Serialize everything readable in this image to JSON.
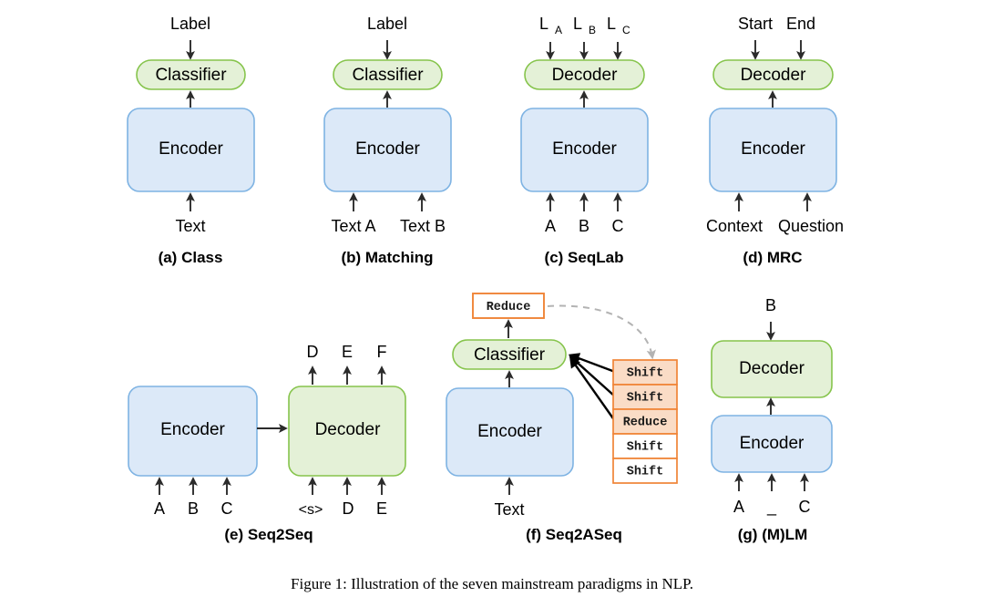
{
  "figure": {
    "caption": "Figure 1: Illustration of the seven mainstream paradigms in NLP.",
    "background": "#ffffff"
  },
  "colors": {
    "encoder_fill": "#dce9f8",
    "encoder_stroke": "#7eb3e3",
    "decoder_fill": "#e4f1d7",
    "decoder_stroke": "#86c44c",
    "stack_fill": "#fadcc6",
    "stack_fill_empty": "#ffffff",
    "stack_stroke": "#f08437",
    "arrow": "#2b2b2b",
    "dashed_arrow": "#b3b3b3",
    "text": "#000000"
  },
  "blocks": {
    "encoder": "Encoder",
    "decoder": "Decoder",
    "classifier": "Classifier"
  },
  "panels": [
    {
      "id": "class",
      "caption": "(a) Class",
      "top_block": "Classifier",
      "bottom_block": "Encoder",
      "outputs": [
        "Label"
      ],
      "inputs": [
        "Text"
      ]
    },
    {
      "id": "matching",
      "caption": "(b) Matching",
      "top_block": "Classifier",
      "bottom_block": "Encoder",
      "outputs": [
        "Label"
      ],
      "inputs": [
        "Text A",
        "Text B"
      ]
    },
    {
      "id": "seqlab",
      "caption": "(c) SeqLab",
      "top_block": "Decoder",
      "bottom_block": "Encoder",
      "outputs": [
        "L",
        "L",
        "L"
      ],
      "output_subscripts": [
        "A",
        "B",
        "C"
      ],
      "inputs": [
        "A",
        "B",
        "C"
      ]
    },
    {
      "id": "mrc",
      "caption": "(d) MRC",
      "top_block": "Decoder",
      "bottom_block": "Encoder",
      "outputs": [
        "Start",
        "End"
      ],
      "inputs": [
        "Context",
        "Question"
      ]
    },
    {
      "id": "seq2seq",
      "caption": "(e) Seq2Seq",
      "left_block": "Encoder",
      "right_block": "Decoder",
      "left_inputs": [
        "A",
        "B",
        "C"
      ],
      "right_inputs": [
        "<s>",
        "D",
        "E"
      ],
      "outputs": [
        "D",
        "E",
        "F"
      ]
    },
    {
      "id": "seq2aseq",
      "caption": "(f) Seq2ASeq",
      "top_block": "Classifier",
      "bottom_block": "Encoder",
      "inputs": [
        "Text"
      ],
      "predicted_action": "Reduce",
      "action_stack": [
        {
          "label": "Shift",
          "filled": true
        },
        {
          "label": "Shift",
          "filled": true
        },
        {
          "label": "Reduce",
          "filled": true
        },
        {
          "label": "Shift",
          "filled": false
        },
        {
          "label": "Shift",
          "filled": false
        }
      ]
    },
    {
      "id": "mlm",
      "caption": "(g) (M)LM",
      "top_block": "Decoder",
      "bottom_block": "Encoder",
      "outputs": [
        "B"
      ],
      "inputs": [
        "A",
        "_",
        "C"
      ]
    }
  ]
}
